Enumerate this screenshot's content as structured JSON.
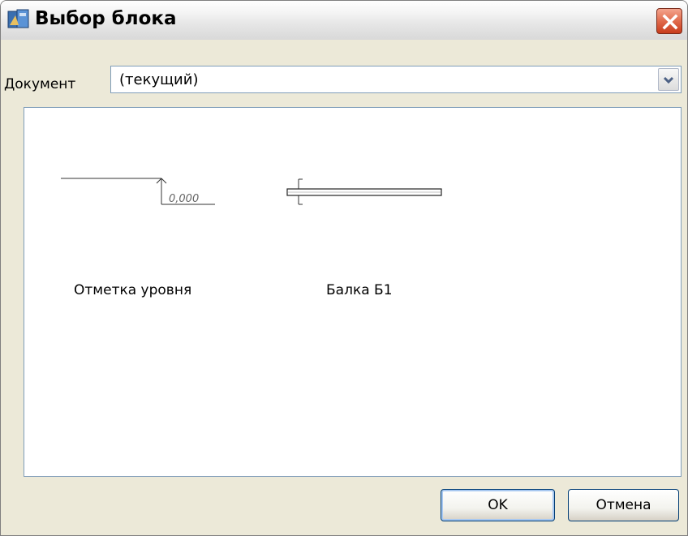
{
  "window": {
    "title": "Выбор блока"
  },
  "document_selector": {
    "label": "Документ",
    "selected_value": "(текущий)"
  },
  "blocks": [
    {
      "label": "Отметка уровня",
      "preview_text": "0,000"
    },
    {
      "label": "Балка Б1"
    }
  ],
  "buttons": {
    "ok_label": "OK",
    "cancel_label": "Отмена"
  },
  "colors": {
    "close_button": "#d9583a",
    "field_border": "#7f9db9",
    "dialog_bg": "#ece9d8"
  }
}
